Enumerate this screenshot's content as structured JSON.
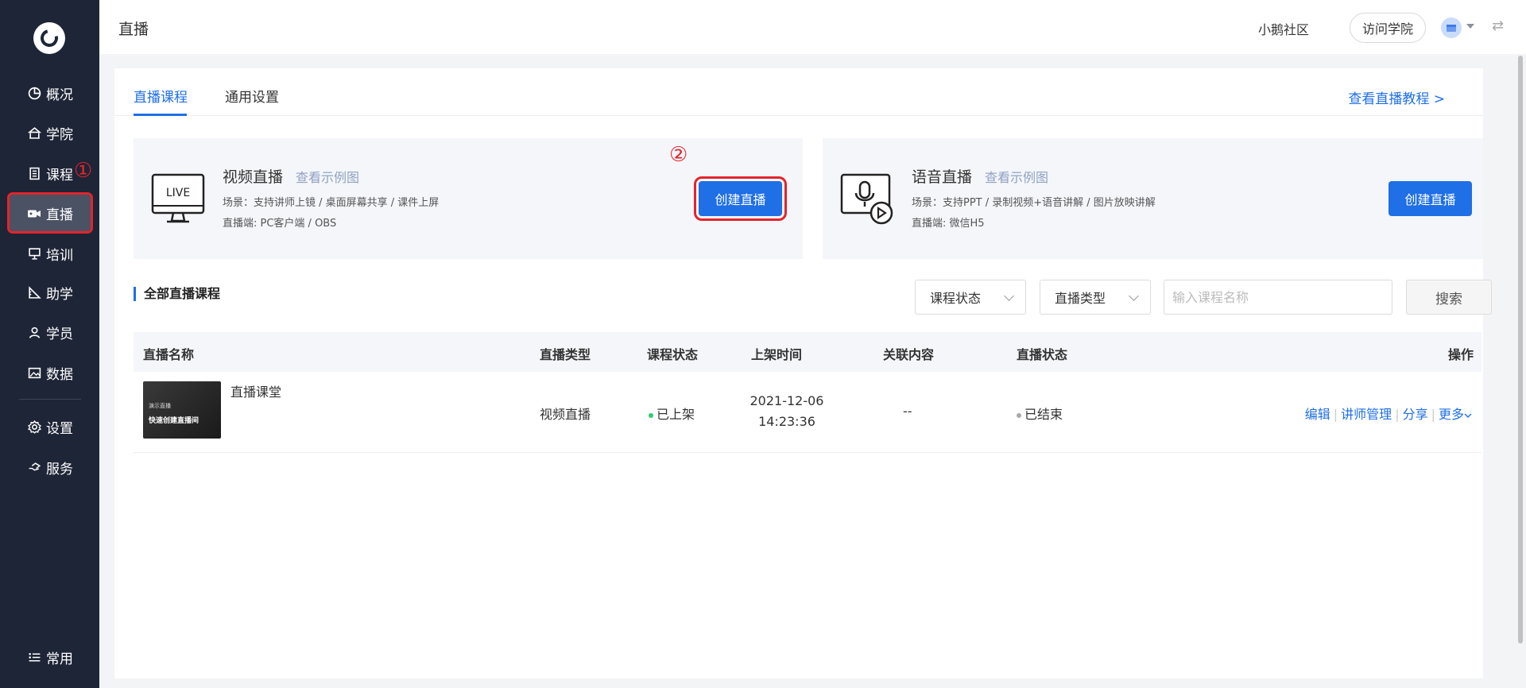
{
  "sidebar": {
    "items": [
      {
        "label": "概况",
        "icon": "pie-chart-icon"
      },
      {
        "label": "学院",
        "icon": "college-icon"
      },
      {
        "label": "课程",
        "icon": "document-icon"
      },
      {
        "label": "直播",
        "icon": "video-camera-icon",
        "active": true
      },
      {
        "label": "培训",
        "icon": "training-icon"
      },
      {
        "label": "助学",
        "icon": "ruler-icon"
      },
      {
        "label": "学员",
        "icon": "user-icon"
      },
      {
        "label": "数据",
        "icon": "image-icon"
      },
      {
        "label": "设置",
        "icon": "gear-icon"
      },
      {
        "label": "服务",
        "icon": "service-icon"
      }
    ],
    "bottom_item": {
      "label": "常用",
      "icon": "list-icon"
    }
  },
  "annotations": {
    "one": "①",
    "two": "②"
  },
  "header": {
    "title": "直播",
    "community": "小鹅社区",
    "visit_button": "访问学院",
    "swap_icon": "⇄"
  },
  "tabs": [
    {
      "label": "直播课程",
      "active": true
    },
    {
      "label": "通用设置"
    }
  ],
  "tutorial_link": "查看直播教程 >",
  "live_cards": [
    {
      "title": "视频直播",
      "sample_link": "查看示例图",
      "scene": "场景：支持讲师上镜 / 桌面屏幕共享 / 课件上屏",
      "client": "直播端:   PC客户端 / OBS",
      "button": "创建直播",
      "icon_text": "LIVE"
    },
    {
      "title": "语音直播",
      "sample_link": "查看示例图",
      "scene": "场景：支持PPT / 录制视频+语音讲解 / 图片放映讲解",
      "client": "直播端:   微信H5",
      "button": "创建直播"
    }
  ],
  "list": {
    "section_title": "全部直播课程",
    "filter_status": "课程状态",
    "filter_type": "直播类型",
    "search_placeholder": "输入课程名称",
    "search_button": "搜索",
    "columns": [
      "直播名称",
      "直播类型",
      "课程状态",
      "上架时间",
      "关联内容",
      "直播状态",
      "操作"
    ],
    "rows": [
      {
        "name": "直播课堂",
        "thumb_line1": "演示直播",
        "thumb_line2": "快速创建直播间",
        "type": "视频直播",
        "status": "已上架",
        "date": "2021-12-06",
        "time": "14:23:36",
        "related": "--",
        "live_status": "已结束",
        "ops": {
          "edit": "编辑",
          "teacher": "讲师管理",
          "share": "分享",
          "more": "更多"
        }
      }
    ]
  },
  "colors": {
    "primary": "#1f6fe6",
    "sidebar": "#1e2537",
    "highlight": "#e5242b",
    "status_green": "#2ecc71",
    "status_gray": "#aaaaaa"
  }
}
